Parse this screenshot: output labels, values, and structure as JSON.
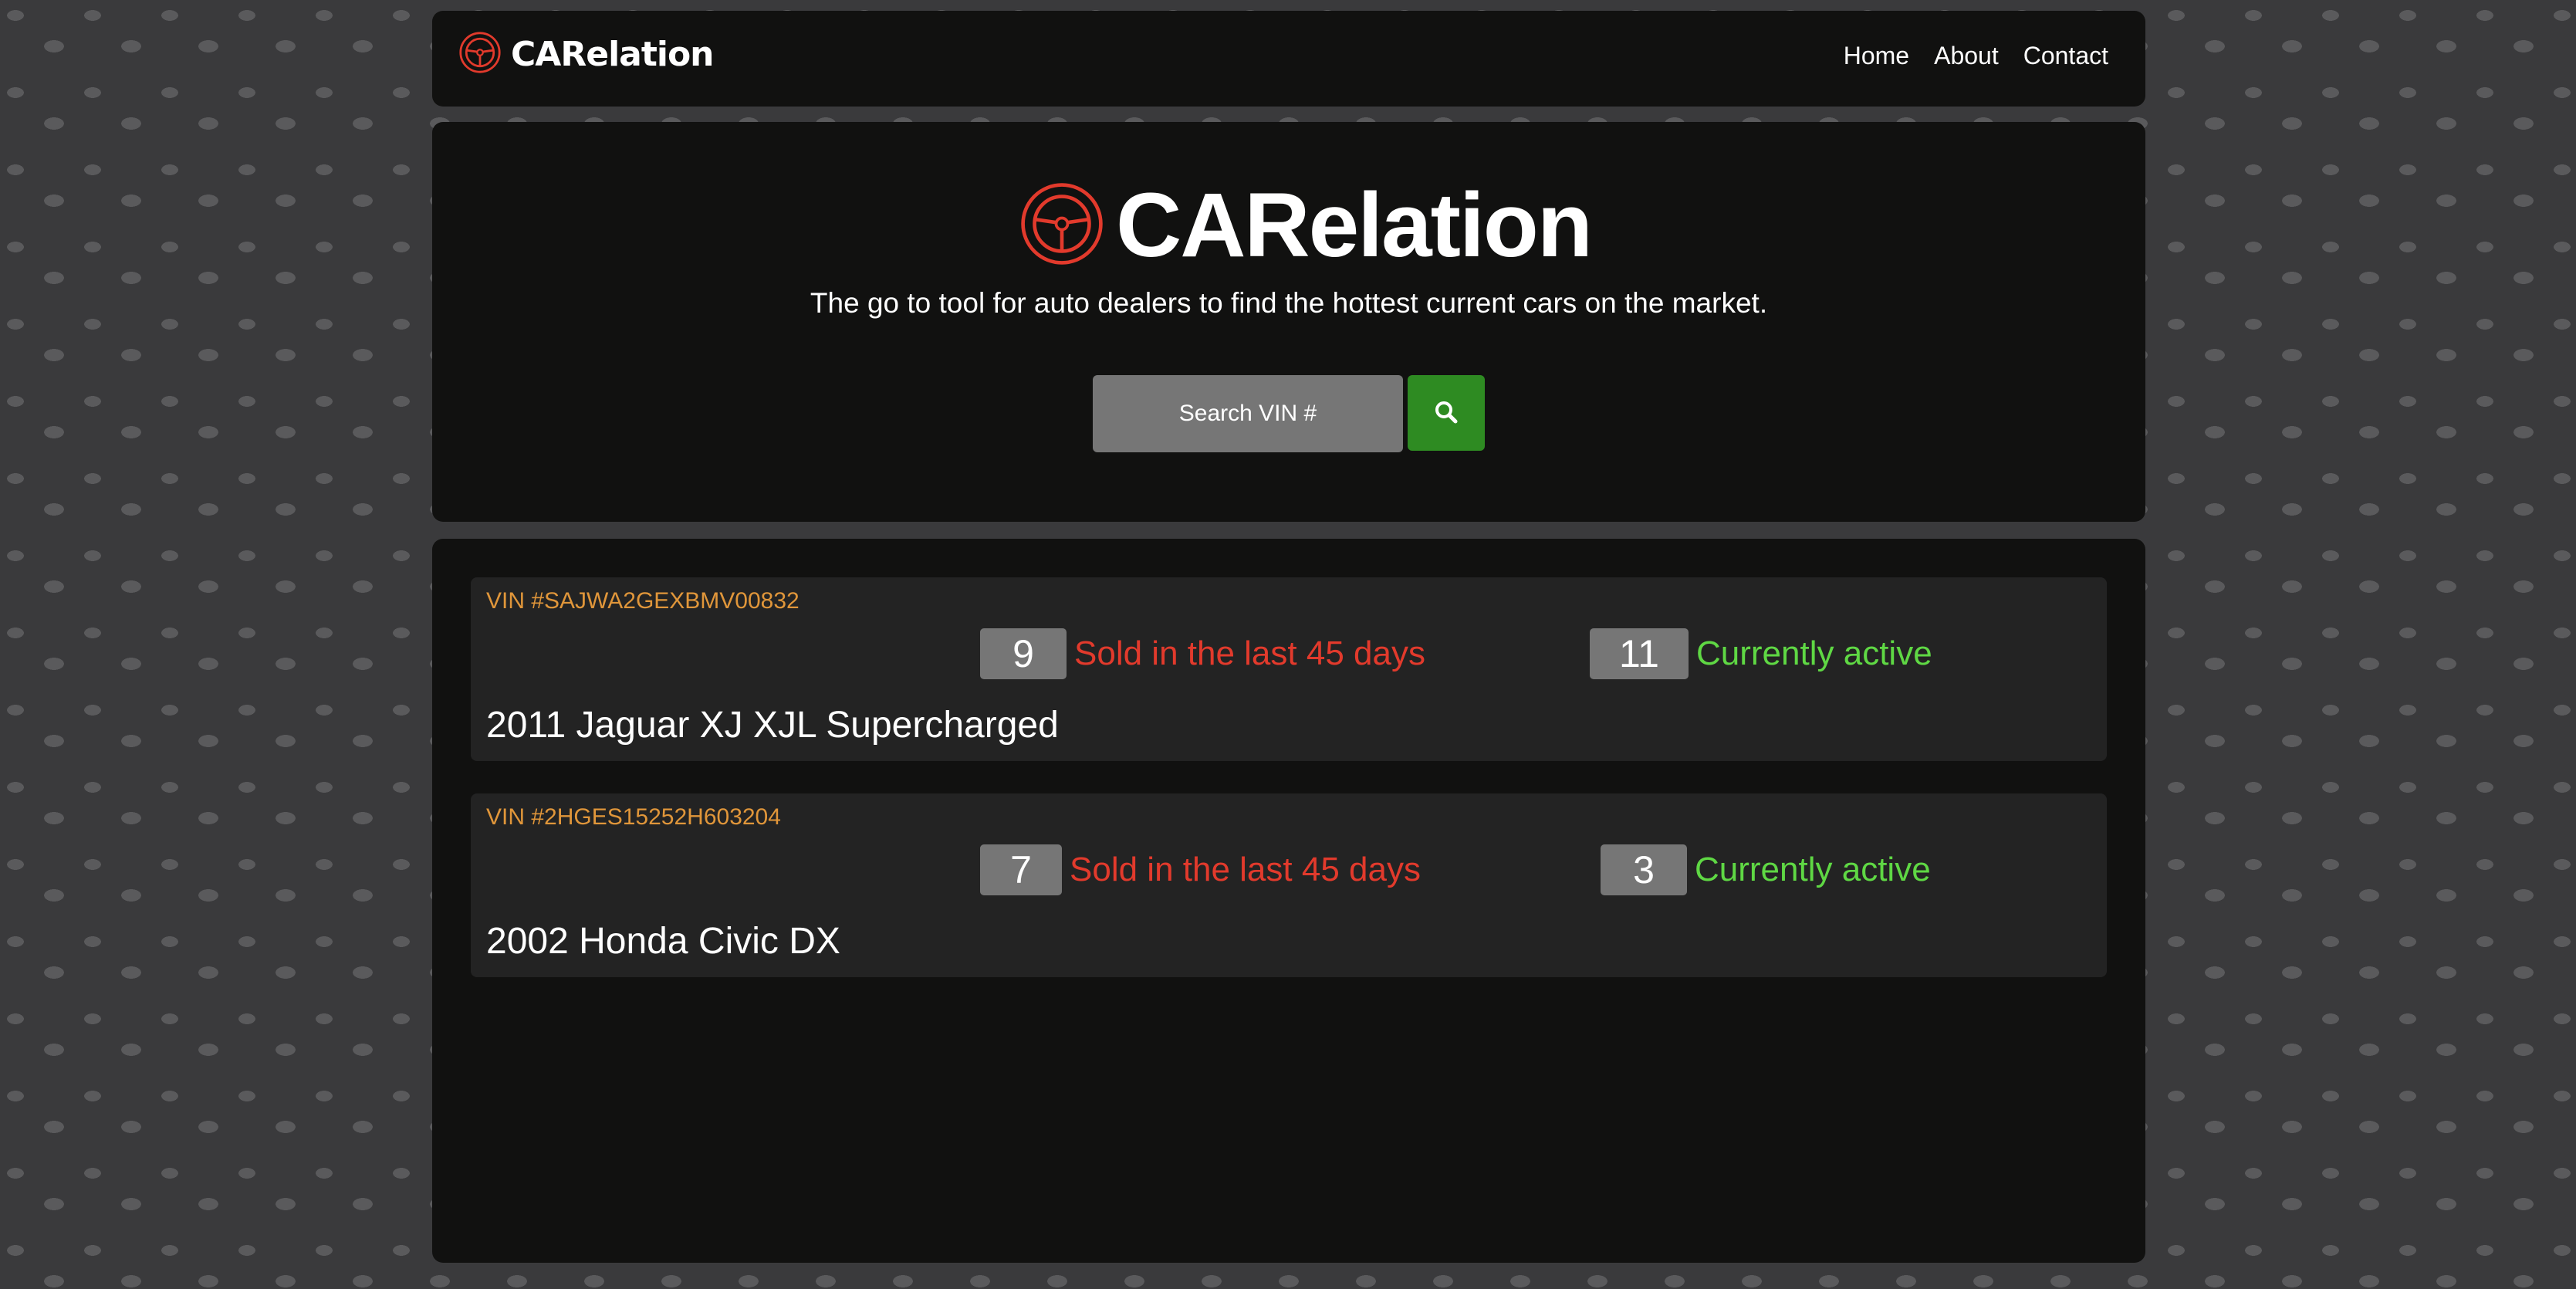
{
  "brand": {
    "name": "CARelation",
    "accent": "#e23a2c"
  },
  "nav": {
    "items": [
      {
        "label": "Home"
      },
      {
        "label": "About"
      },
      {
        "label": "Contact"
      }
    ]
  },
  "hero": {
    "title": "CARelation",
    "tagline": "The go to tool for auto dealers to find the hottest current cars on the market."
  },
  "search": {
    "placeholder": "Search VIN #",
    "button_icon": "search-icon",
    "button_color": "#2e8b22"
  },
  "results": [
    {
      "vin": "VIN #SAJWA2GEXBMV00832",
      "sold_count": "9",
      "sold_label": "Sold in the last 45 days",
      "active_count": "11",
      "active_label": "Currently active",
      "model": "2011 Jaguar XJ XJL Supercharged"
    },
    {
      "vin": "VIN #2HGES15252H603204",
      "sold_count": "7",
      "sold_label": "Sold in the last 45 days",
      "active_count": "3",
      "active_label": "Currently active",
      "model": "2002 Honda Civic DX"
    }
  ],
  "colors": {
    "sold": "#e23a2c",
    "active": "#5fd844",
    "vin": "#e0963a"
  }
}
